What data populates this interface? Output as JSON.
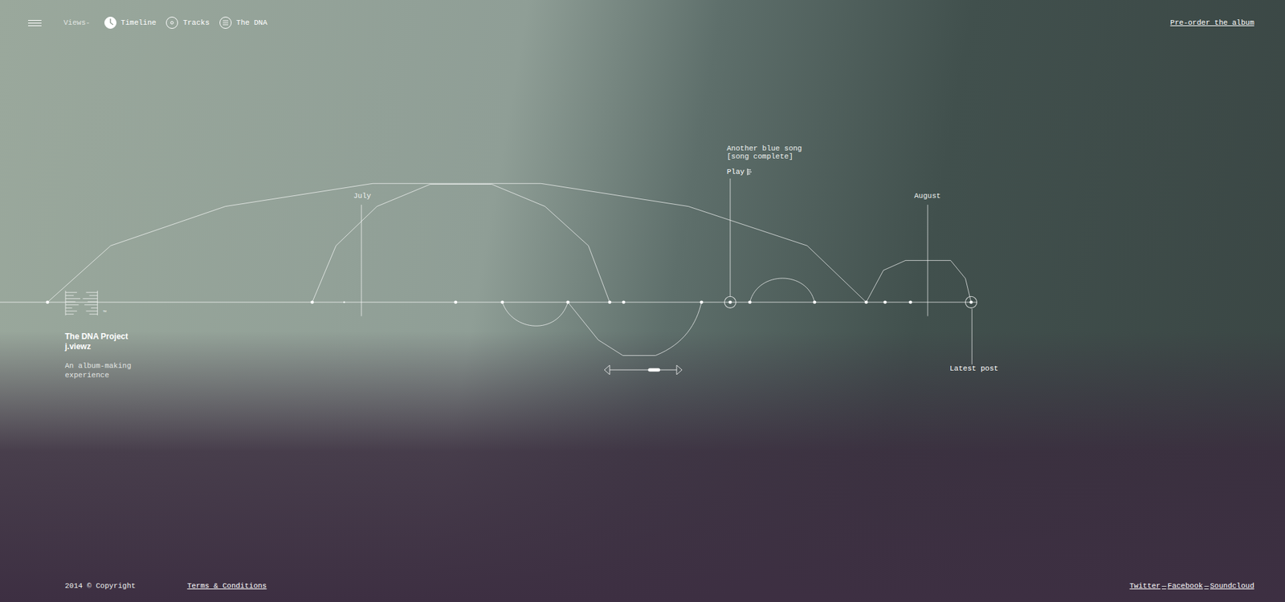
{
  "nav": {
    "views_label": "Views-",
    "views": [
      {
        "label": "Timeline",
        "selected": true
      },
      {
        "label": "Tracks",
        "selected": false
      },
      {
        "label": "The DNA",
        "selected": false
      }
    ],
    "cta": "Pre-order the album"
  },
  "project": {
    "title": "The DNA Project",
    "artist": "j.viewz",
    "tagline": "An album-making experience",
    "mark": "™"
  },
  "timeline": {
    "months": [
      {
        "label": "July"
      },
      {
        "label": "August"
      }
    ],
    "song": {
      "title": "Another blue song",
      "status": "[song complete]",
      "action": "Play"
    },
    "latest": "Latest post",
    "nodes": [
      {
        "kind": "dot"
      },
      {
        "kind": "dot"
      },
      {
        "kind": "small"
      },
      {
        "kind": "dot"
      },
      {
        "kind": "dot"
      },
      {
        "kind": "dot"
      },
      {
        "kind": "dot"
      },
      {
        "kind": "dot"
      },
      {
        "kind": "dot"
      },
      {
        "kind": "ring"
      },
      {
        "kind": "dot"
      },
      {
        "kind": "dot"
      },
      {
        "kind": "dot"
      },
      {
        "kind": "dot"
      },
      {
        "kind": "dot"
      },
      {
        "kind": "ring"
      }
    ],
    "scroll": {
      "level": 0.58
    }
  },
  "footer": {
    "copyright": "2014 © Copyright",
    "terms": "Terms & Conditions",
    "social": [
      "Twitter",
      "Facebook",
      "Soundcloud"
    ],
    "separator": "—"
  }
}
